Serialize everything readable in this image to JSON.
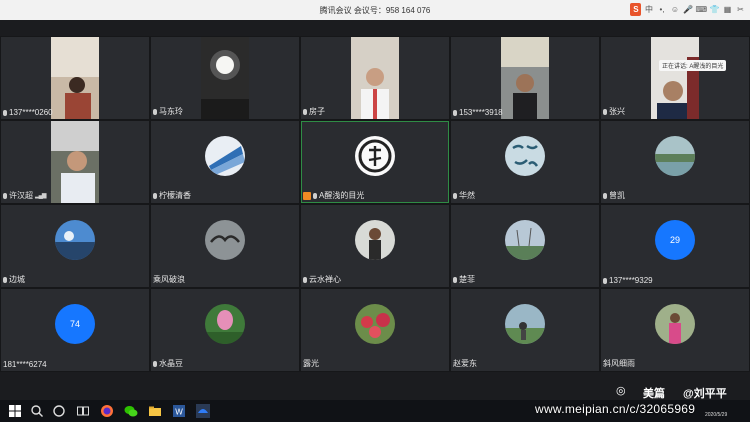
{
  "window": {
    "title": "腾讯会议 会议号：958 164 076"
  },
  "tray_icons": [
    "S",
    "中",
    "•,",
    "☺",
    "🎤",
    "⌨",
    "👕",
    "▦",
    "✂"
  ],
  "speaking_tip": "正在讲话: A醒浅的目光",
  "participants": [
    {
      "name": "137****0260",
      "kind": "video"
    },
    {
      "name": "马东玲",
      "kind": "video"
    },
    {
      "name": "房子",
      "kind": "video"
    },
    {
      "name": "153****3918",
      "kind": "video"
    },
    {
      "name": "张兴",
      "kind": "video"
    },
    {
      "name": "许汉超",
      "kind": "video"
    },
    {
      "name": "柠檬清香",
      "kind": "avatar"
    },
    {
      "name": "A醒浅的目光",
      "kind": "avatar"
    },
    {
      "name": "华然",
      "kind": "avatar"
    },
    {
      "name": "曾凯",
      "kind": "avatar"
    },
    {
      "name": "边城",
      "kind": "avatar"
    },
    {
      "name": "乘风破浪",
      "kind": "avatar"
    },
    {
      "name": "云水禅心",
      "kind": "avatar"
    },
    {
      "name": "楚菲",
      "kind": "avatar"
    },
    {
      "name": "137****9329",
      "kind": "number",
      "number": "29"
    },
    {
      "name": "181****6274",
      "kind": "number",
      "number": "74"
    },
    {
      "name": "水晶豆",
      "kind": "avatar"
    },
    {
      "name": "露光",
      "kind": "avatar"
    },
    {
      "name": "赵爱东",
      "kind": "avatar"
    },
    {
      "name": "斜风细雨",
      "kind": "avatar"
    }
  ],
  "watermark": {
    "brand": "美篇",
    "author": "@刘平平",
    "url": "www.meipian.cn/c/32065969"
  },
  "clock_date": "2020/5/29"
}
